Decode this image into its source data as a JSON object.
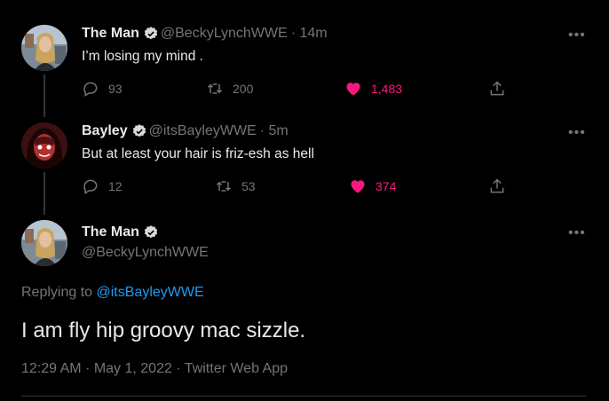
{
  "tweets": [
    {
      "name": "The Man",
      "handle": "@BeckyLynchWWE",
      "time": "· 14m",
      "text": "I’m losing my mind .",
      "replies": "93",
      "retweets": "200",
      "likes": "1,483"
    },
    {
      "name": "Bayley",
      "handle": "@itsBayleyWWE",
      "time": "· 5m",
      "text": "But at least your hair is friz-esh as hell",
      "replies": "12",
      "retweets": "53",
      "likes": "374"
    }
  ],
  "main_tweet": {
    "name": "The Man",
    "handle": "@BeckyLynchWWE",
    "replying_prefix": "Replying to",
    "replying_to": "@itsBayleyWWE",
    "text": "I am fly hip groovy mac sizzle.",
    "timestamp": "12:29 AM · May 1, 2022 · Twitter Web App"
  },
  "more_glyph": "•••",
  "colors": {
    "background": "#000000",
    "text": "#e7e9ea",
    "muted": "#71767b",
    "like": "#f91880",
    "link": "#1d9bf0",
    "verified": "#d9d9d9"
  }
}
